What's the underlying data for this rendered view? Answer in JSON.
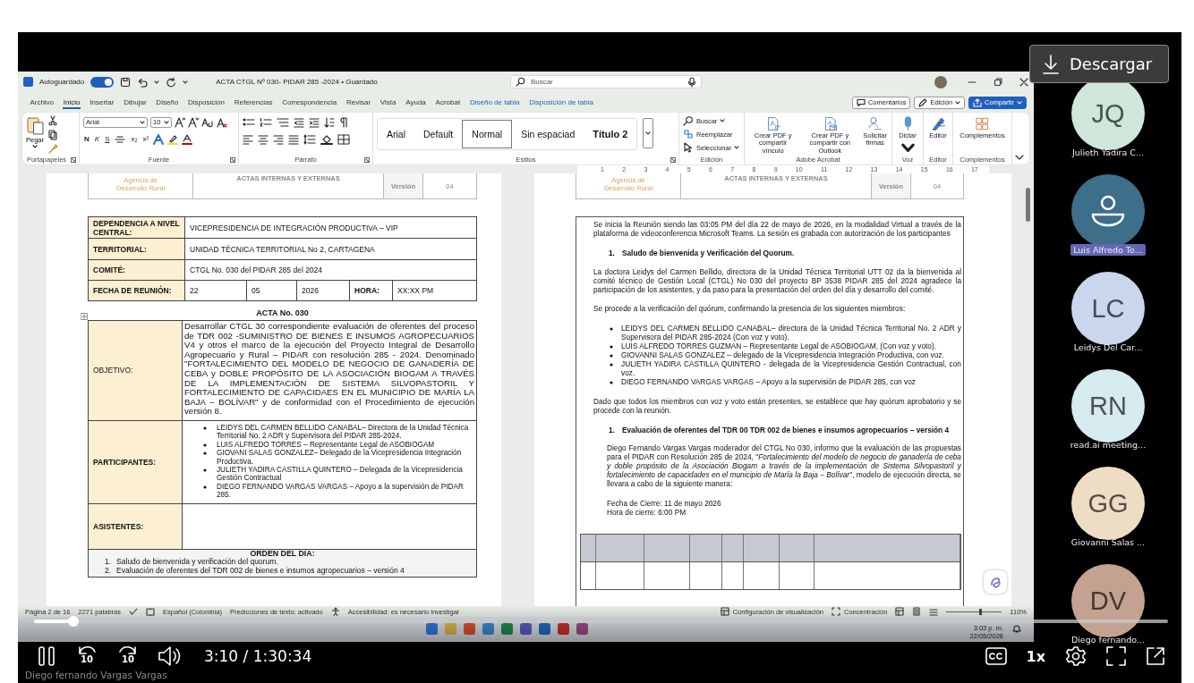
{
  "word": {
    "title_bar": {
      "autosave_label": "Autoguardado",
      "autosave_on": true,
      "title": "ACTA CTGL Nº 030- PIDAR 285 -2024 • Guardado",
      "search_placeholder": "Buscar"
    },
    "menu_tabs": [
      {
        "label": "Archivo",
        "selected": false,
        "kind": "standard"
      },
      {
        "label": "Inicio",
        "selected": true,
        "kind": "standard"
      },
      {
        "label": "Insertar",
        "selected": false,
        "kind": "standard"
      },
      {
        "label": "Dibujar",
        "selected": false,
        "kind": "standard"
      },
      {
        "label": "Diseño",
        "selected": false,
        "kind": "standard"
      },
      {
        "label": "Disposición",
        "selected": false,
        "kind": "standard"
      },
      {
        "label": "Referencias",
        "selected": false,
        "kind": "standard"
      },
      {
        "label": "Correspondencia",
        "selected": false,
        "kind": "standard"
      },
      {
        "label": "Revisar",
        "selected": false,
        "kind": "standard"
      },
      {
        "label": "Vista",
        "selected": false,
        "kind": "standard"
      },
      {
        "label": "Ayuda",
        "selected": false,
        "kind": "standard"
      },
      {
        "label": "Acrobat",
        "selected": false,
        "kind": "standard"
      },
      {
        "label": "Diseño de tabla",
        "selected": false,
        "kind": "contextual"
      },
      {
        "label": "Disposición de tabla",
        "selected": false,
        "kind": "contextual"
      }
    ],
    "menu_buttons": [
      {
        "label": "Comentarios",
        "kind": "comments"
      },
      {
        "label": "Edición",
        "kind": "editing"
      },
      {
        "label": "Compartir",
        "kind": "share"
      }
    ],
    "ribbon": [
      {
        "kind": "clipboard",
        "label": "Portapapeles",
        "paste": "Pegar"
      },
      {
        "kind": "font",
        "label": "Fuente",
        "font": "Arial",
        "size": "10",
        "format": [
          "N",
          "K",
          "S"
        ],
        "scripts": [
          "x₂",
          "x²"
        ]
      },
      {
        "kind": "paragraph",
        "label": "Párrafo"
      },
      {
        "kind": "styles",
        "label": "Estilos",
        "styles": [
          {
            "label": "Arial",
            "selected": false
          },
          {
            "label": "Default",
            "selected": false
          },
          {
            "label": "Normal",
            "selected": true
          },
          {
            "label": "Sin espaciad",
            "selected": false
          },
          {
            "label": "Título 2",
            "selected": false
          }
        ]
      },
      {
        "kind": "editing",
        "label": "Edición",
        "items": [
          "Buscar",
          "Reemplazar",
          "Seleccionar"
        ]
      },
      {
        "kind": "large_buttons",
        "label": "Adobe Acrobat",
        "items": [
          {
            "label": "Crear PDF y compartir vínculo",
            "kind": "pdf_link"
          },
          {
            "label": "Crear PDF y compartir con Outlook",
            "kind": "pdf_mail"
          },
          {
            "label": "Solicitar firmas",
            "kind": "signature"
          }
        ]
      },
      {
        "kind": "large_buttons",
        "label": "Voz",
        "items": [
          {
            "label": "Dictar",
            "kind": "microphone"
          }
        ]
      },
      {
        "kind": "large_buttons",
        "label": "Editor",
        "items": [
          {
            "label": "Editor",
            "kind": "editor"
          }
        ]
      },
      {
        "kind": "large_buttons",
        "label": "Complementos",
        "items": [
          {
            "label": "Complementos",
            "kind": "addins"
          }
        ]
      }
    ],
    "ruler": [
      "1",
      "2",
      "3",
      "4",
      "5",
      "6",
      "7",
      "8",
      "9",
      "10",
      "11",
      "12",
      "13",
      "14",
      "15",
      "16",
      "17"
    ],
    "pages": [
      {
        "header": {
          "logo": [
            "Agencia de",
            "Desarrollo Rural"
          ],
          "title": "ACTAS INTERNAS Y EXTERNAS",
          "version_label": "Versión",
          "version": "04"
        },
        "blocks": [
          {
            "kind": "info_table",
            "rows": [
              {
                "kind": "text",
                "label": "DEPENDENCIA A NIVEL CENTRAL:",
                "value": "VICEPRESIDENCIA DE INTEGRACIÓN PRODUCTIVA – VIP"
              },
              {
                "kind": "text",
                "label": "TERRITORIAL:",
                "value": "UNIDAD TÉCNICA TERRITORIAL No 2, CARTAGENA"
              },
              {
                "kind": "text",
                "label": "COMITÉ:",
                "value": "CTGL No. 030 del PIDAR 285 del 2024"
              },
              {
                "kind": "date",
                "label": "FECHA DE REUNIÓN:",
                "cells": [
                  "22",
                  "05",
                  "2026"
                ],
                "hour_label": "HORA:",
                "hour": "XX:XX PM"
              }
            ]
          },
          {
            "kind": "title",
            "text": "ACTA No. 030"
          },
          {
            "kind": "section_table",
            "rows": [
              {
                "kind": "text",
                "label": "OBJETIVO:",
                "label_bold": false,
                "text": "Desarrollar CTGL  30 correspondiente evaluación de oferentes del proceso de TDR 002 -SUMINISTRO DE BIENES E INSUMOS AGROPECUARIOS V4 y otros el marco de la ejecución del Proyecto Integral de Desarrollo Agropecuario y Rural – PIDAR con resolución 285 - 2024. Denominado \"FORTALECIMIENTO DEL MODELO DE NEGOCIO DE GANADERÍA DE CEBA y DOBLE PROPÓSITO DE LA ASOCIACIÓN BIOGAM A TRAVÉS DE LA IMPLEMENTACIÓN DE SISTEMA SILVOPASTORIL Y FORTALECIMIENTO DE CAPACIDAES EN EL MUNICIPIO DE MARÍA LA BAJA – BOLÍVAR\" y de conformidad con el Procedimiento de ejecución versión 8."
              },
              {
                "kind": "bullets",
                "label": "PARTICIPANTES:",
                "label_bold": true,
                "items": [
                  "LEIDYS DEL CARMEN BELLIDO CANABAL– Directora de la Unidad Técnica Territorial No. 2 ADR y Supervisora del PIDAR 285-2024.",
                  "LUIS ALFREDO TORRES – Representante Legal de ASOBIOGAM",
                  "GIOVANI SALAS GONZALEZ– Delegado de la Vicepresidencia Integración Productiva.",
                  "JULIETH YADIRA CASTILLA QUINTERO – Delegada de la Vicepresidencia Gestión Contractual",
                  "DIEGO FERNANDO VARGAS VARGAS – Apoyo a la supervisión de PIDAR  285."
                ]
              },
              {
                "kind": "empty",
                "label": "ASISTENTES:",
                "label_bold": true
              }
            ]
          },
          {
            "kind": "numbered_section",
            "title": "ORDEN DEL DÍA:",
            "items": [
              {
                "number": "1.",
                "text": "Saludo de bienvenida y verificación del quorum."
              },
              {
                "number": "2.",
                "text": "Evaluación de oferentes del TDR 002 de bienes e insumos agropecuarios – versión 4"
              }
            ]
          }
        ]
      },
      {
        "header": {
          "logo": [
            "Agencia de",
            "Desarrollo Rural"
          ],
          "title": "ACTAS INTERNAS Y EXTERNAS",
          "version_label": "Versión",
          "version": "04"
        },
        "blocks": [
          {
            "kind": "box",
            "blocks": [
              {
                "kind": "paragraph",
                "text": "Se inicia la Reunión siendo las 03:05 PM del día 22 de mayo de 2026, en la modalidad Virtual a través de la plataforma de videoconferencia Microsoft Teams. La sesión es grabada con autorización de los participantes"
              },
              {
                "kind": "heading",
                "number": "1.",
                "text": "Saludo de bienvenida y Verificación del Quorum."
              },
              {
                "kind": "paragraph",
                "text": "La doctora Leidys del Carmen Bellido, directora de la Unidad Técnica Territorial UTT 02 da la bienvenida al comité técnico de Gestión Local (CTGL) No 030 del proyecto BP 3538 PIDAR  285 del 2024 agradece la participación de los asistentes, y da paso para la presentación del orden del día y desarrollo del comité."
              },
              {
                "kind": "paragraph",
                "text": "Se procede a la verificación del quórum, confirmando la presencia de los siguientes miembros:"
              },
              {
                "kind": "bullets",
                "items": [
                  "LEIDYS DEL CARMEN BELLIDO CANABAL– directora de la Unidad Técnica Territorial No. 2 ADR y Supervisora del PIDAR 285-2024 (Con voz y voto).",
                  "LUIS ALFREDO TORRES GUZMAN – Representante Legal de ASOBIOGAM, (Con voz y voto).",
                  "GIOVANNI SALAS GONZALEZ – delegado de la Vicepresidencia Integración Productiva, con voz.",
                  "JULIETH YADIRA CASTILLA QUINTERO - delegada de la Vicepresidencia Gestión Contractual, con voz.",
                  "DIEGO FERNANDO VARGAS VARGAS – Apoyo a la supervisión de PIDAR 285, con voz"
                ]
              },
              {
                "kind": "paragraph",
                "text": "Dado que todos los miembros con voz y voto están presentes, se establece que hay quórum aprobatorio y se procede con la reunión."
              },
              {
                "kind": "heading",
                "number": "1.",
                "text": "Evaluación de oferentes del TDR 00 TDR 002 de bienes e insumos agropecuarios – versión 4"
              },
              {
                "kind": "indented_paragraph",
                "text": "Diego Fernando Vargas Vargas moderador del CTGL No 030, informo que la evaluación de las propuestas para el PIDAR con Resolución 285 de 2024, \"*Fortalecimiento del modelo de negocio de ganadería de ceba y doble propósito de la Asociación Biogam a través de la implementación de Sistema Silvopastoril y fortalecimiento de capacidades en el municipio de María la Baja – Bolívar*\", modelo de ejecución directa, se llevara a cabo de la siguiente manera:"
              },
              {
                "kind": "lines",
                "lines": [
                  "Fecha de Cierre: 11 de mayo 2026",
                  "Hora de cierre: 6:00 PM"
                ]
              },
              {
                "kind": "table_stub"
              }
            ]
          }
        ]
      }
    ],
    "status_bar": {
      "left": [
        "Página 2 de 16",
        "2271 palabras",
        "Español (Colombia)",
        "Predicciones de texto: activado",
        "Accesibilidad: es necesario investigar"
      ],
      "right": [
        "Configuración de visualización",
        "Concentración"
      ],
      "zoom": {
        "level": 0.6,
        "label": "110%"
      }
    },
    "taskbar": {
      "time": "3:03 p. m.",
      "date": "22/05/2026"
    }
  },
  "player": {
    "download": "Descargar",
    "progress": {
      "level": 0.035
    },
    "skip_back": "10",
    "skip_forward": "10",
    "time": "3:10 / 1:30:34",
    "speed": "1x",
    "recorded_by": "Diego fernando Vargas Vargas"
  },
  "participants": [
    {
      "kind": "initials",
      "initials": "JQ",
      "name": "Julieth Yadira C...",
      "color": "#cfe6da",
      "highlighted": false
    },
    {
      "kind": "icon",
      "name": "Luis Alfredo To...",
      "color": "#3d6e8a",
      "highlighted": true
    },
    {
      "kind": "initials",
      "initials": "LC",
      "name": "Leidys Del Car...",
      "color": "#c9d6ec",
      "highlighted": false
    },
    {
      "kind": "initials",
      "initials": "RN",
      "name": "read.ai meeting...",
      "color": "#d5ebf0",
      "highlighted": false
    },
    {
      "kind": "initials",
      "initials": "GG",
      "name": "Giovanni Salas ...",
      "color": "#efdcc4",
      "highlighted": false
    },
    {
      "kind": "initials",
      "initials": "DV",
      "name": "Diego fernando...",
      "color": "#c4a291",
      "highlighted": false
    }
  ]
}
